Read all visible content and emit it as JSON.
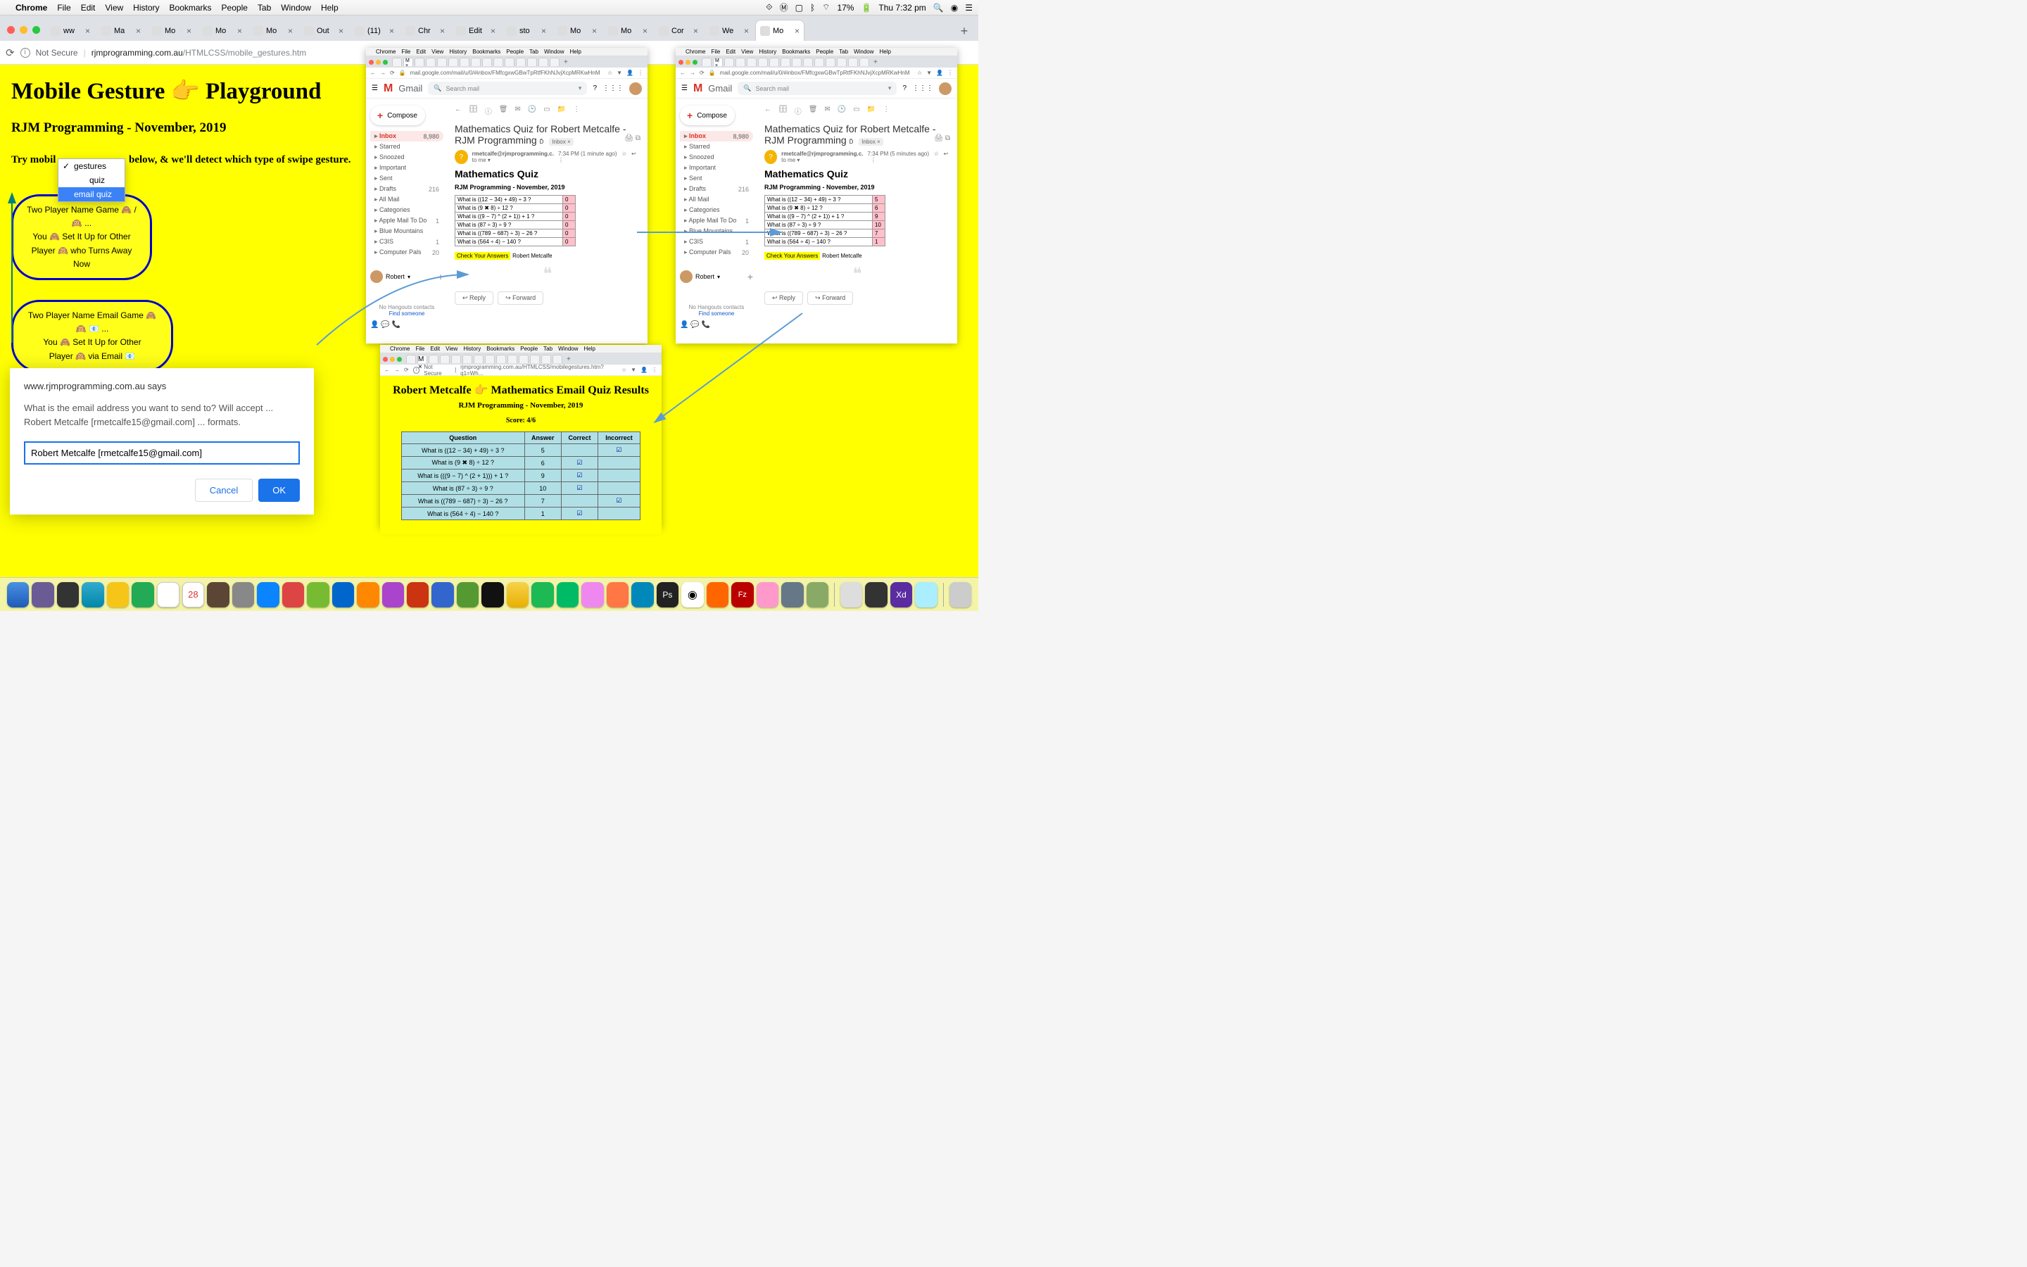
{
  "mac_menu": {
    "app": "Chrome",
    "items": [
      "File",
      "Edit",
      "View",
      "History",
      "Bookmarks",
      "People",
      "Tab",
      "Window",
      "Help"
    ],
    "battery": "17%",
    "clock": "Thu 7:32 pm"
  },
  "chrome_tabs": [
    "ww",
    "Ma",
    "Mo",
    "Mo",
    "Mo",
    "Out",
    "(11)",
    "Chr",
    "Edit",
    "sto",
    "Mo",
    "Mo",
    "Cor",
    "We",
    "Mo"
  ],
  "address": {
    "not_secure": "Not Secure",
    "host": "rjmprogramming.com.au",
    "path": "/HTMLCSS/mobile_gestures.htm"
  },
  "page": {
    "title_a": "Mobile Gesture ",
    "title_b": " Playground",
    "subtitle": "RJM Programming - November, 2019",
    "try_a": "Try mobil",
    "try_b": " below, & we'll detect which type of swipe gesture."
  },
  "dropdown": {
    "opt1": "gestures",
    "opt2": "quiz",
    "opt3": "email quiz"
  },
  "capsule1": {
    "l1": "Two Player Name Game 🙈 / 🙉 ...",
    "l2": "You 🙈  Set It Up for Other",
    "l3": "Player 🙉  who Turns Away Now"
  },
  "capsule2": {
    "l1": "Two Player Name Email Game 🙈 🙉 📧 ...",
    "l2": "You 🙈  Set It Up for Other",
    "l3": "Player 🙉  via Email 📧"
  },
  "prompt": {
    "host": "www.rjmprogramming.com.au says",
    "msg": "What is the email address you want to send to?  Will accept ... Robert Metcalfe [rmetcalfe15@gmail.com] ... formats.",
    "value": "Robert Metcalfe [rmetcalfe15@gmail.com]",
    "cancel": "Cancel",
    "ok": "OK"
  },
  "gmail": {
    "menubar": [
      "Chrome",
      "File",
      "Edit",
      "View",
      "History",
      "Bookmarks",
      "People",
      "Tab",
      "Window",
      "Help"
    ],
    "addr": "mail.google.com/mail/u/0/#inbox/FMfcgxwGBwTpRtfFKhNJvjXcpMRKwHnM",
    "brand": "Gmail",
    "search_ph": "Search mail",
    "compose": "Compose",
    "folders": [
      {
        "name": "Inbox",
        "count": "8,980",
        "cls": "inbox"
      },
      {
        "name": "Starred"
      },
      {
        "name": "Snoozed"
      },
      {
        "name": "Important"
      },
      {
        "name": "Sent"
      },
      {
        "name": "Drafts",
        "count": "216"
      },
      {
        "name": "All Mail"
      },
      {
        "name": "Categories"
      },
      {
        "name": "Apple Mail To Do",
        "count": "1"
      },
      {
        "name": "Blue Mountains"
      },
      {
        "name": "C3IS",
        "count": "1"
      },
      {
        "name": "Computer Pals",
        "count": "20"
      }
    ],
    "hangouts": "No Hangouts contacts",
    "find": "Find someone",
    "robert": "Robert",
    "subject": "Mathematics Quiz for Robert Metcalfe - RJM Programming",
    "inbox_chip": "Inbox ×",
    "from": "rmetcalfe@rjmprogramming.c.",
    "tome": "to me",
    "h2": "Mathematics Quiz",
    "sub2": "RJM Programming - November, 2019",
    "time1": "7:34 PM (1 minute ago)",
    "time5": "7:34 PM (5 minutes ago)",
    "check": "Check Your Answers",
    "author": "Robert Metcalfe",
    "reply": "Reply",
    "forward": "Forward",
    "questions": [
      "What is ((12 − 34) + 49) ÷ 3 ?",
      "What is (9 ✖ 8) ÷ 12 ?",
      "What is ((9 − 7) ^ (2 + 1)) + 1 ?",
      "What is (87 ÷ 3) ÷ 9 ?",
      "What is ((789 − 687) ÷ 3) − 26 ?",
      "What is (564 ÷ 4) − 140 ?"
    ],
    "ans_left": [
      "0",
      "0",
      "0",
      "0",
      "0",
      "0"
    ],
    "ans_right": [
      "5",
      "6",
      "9",
      "10",
      "7",
      "1"
    ]
  },
  "results": {
    "addr_ns": "Not Secure",
    "addr": "rjmprogramming.com.au/HTMLCSS/mobilegestures.htm?q1=Wh...",
    "title": "Robert Metcalfe 👉 Mathematics Email Quiz Results",
    "sub": "RJM Programming - November, 2019",
    "score": "Score: 4/6",
    "headers": [
      "Question",
      "Answer",
      "Correct",
      "Incorrect"
    ],
    "rows": [
      {
        "q": "What is ((12 − 34) + 49) ÷ 3 ?",
        "a": "5",
        "c": "",
        "i": "☑"
      },
      {
        "q": "What is (9 ✖ 8) ÷ 12 ?",
        "a": "6",
        "c": "☑",
        "i": ""
      },
      {
        "q": "What is (((9 − 7) ^ (2 + 1))) + 1 ?",
        "a": "9",
        "c": "☑",
        "i": ""
      },
      {
        "q": "What is (87 ÷ 3) ÷ 9 ?",
        "a": "10",
        "c": "☑",
        "i": ""
      },
      {
        "q": "What is ((789 − 687) ÷ 3) − 26 ?",
        "a": "7",
        "c": "",
        "i": "☑"
      },
      {
        "q": "What is (564 ÷ 4) − 140 ?",
        "a": "1",
        "c": "☑",
        "i": ""
      }
    ]
  },
  "chart_data": {
    "type": "table",
    "title": "Mathematics Email Quiz Results",
    "columns": [
      "Question",
      "Answer",
      "Correct",
      "Incorrect"
    ],
    "rows": [
      [
        "What is ((12 − 34) + 49) ÷ 3 ?",
        "5",
        false,
        true
      ],
      [
        "What is (9 ✖ 8) ÷ 12 ?",
        "6",
        true,
        false
      ],
      [
        "What is (((9 − 7) ^ (2 + 1))) + 1 ?",
        "9",
        true,
        false
      ],
      [
        "What is (87 ÷ 3) ÷ 9 ?",
        "10",
        true,
        false
      ],
      [
        "What is ((789 − 687) ÷ 3) − 26 ?",
        "7",
        false,
        true
      ],
      [
        "What is (564 ÷ 4) − 140 ?",
        "1",
        true,
        false
      ]
    ],
    "score": "4/6"
  }
}
